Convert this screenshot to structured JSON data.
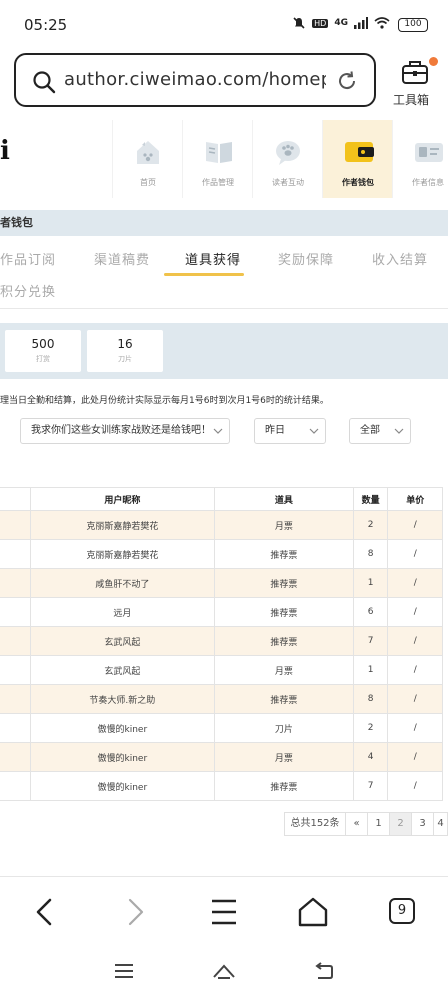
{
  "status_bar": {
    "time": "05:25",
    "network": "4G",
    "hd": "HD",
    "battery": "100"
  },
  "url_bar": {
    "url": "author.ciweimao.com/homepa⋯"
  },
  "toolbox": {
    "label": "工具箱"
  },
  "logo_fragment": "i",
  "nav": [
    {
      "label": "首页",
      "icon": "home-icon"
    },
    {
      "label": "作品管理",
      "icon": "book-icon"
    },
    {
      "label": "读者互动",
      "icon": "paw-chat-icon"
    },
    {
      "label": "作者钱包",
      "icon": "wallet-icon",
      "active": true
    },
    {
      "label": "作者信息",
      "icon": "id-card-icon"
    }
  ],
  "section_title": "者钱包",
  "tabs": [
    {
      "label": "作品订阅"
    },
    {
      "label": "渠道稿费"
    },
    {
      "label": "道具获得",
      "active": true
    },
    {
      "label": "奖励保障"
    },
    {
      "label": "收入结算"
    },
    {
      "label": "积分兑换"
    }
  ],
  "stats": [
    {
      "value": "500",
      "caption": "打赏"
    },
    {
      "value": "16",
      "caption": "刀片"
    }
  ],
  "notice": "理当日全勤和结算，此处月份统计实际显示每月1号6时到次月1号6时的统计结果。",
  "filters": {
    "book": "我求你们这些女训练家战败还是给钱吧！",
    "period": "昨日",
    "type": "全部"
  },
  "table": {
    "headers": [
      "用户昵称",
      "道具",
      "数量",
      "单价"
    ],
    "rows": [
      [
        "克丽斯嘉静若樊花",
        "月票",
        "2",
        "/"
      ],
      [
        "克丽斯嘉静若樊花",
        "推荐票",
        "8",
        "/"
      ],
      [
        "咸鱼肝不动了",
        "推荐票",
        "1",
        "/"
      ],
      [
        "远月",
        "推荐票",
        "6",
        "/"
      ],
      [
        "玄武风起",
        "推荐票",
        "7",
        "/"
      ],
      [
        "玄武风起",
        "月票",
        "1",
        "/"
      ],
      [
        "节奏大师.新之助",
        "推荐票",
        "8",
        "/"
      ],
      [
        "傲慢的kiner",
        "刀片",
        "2",
        "/"
      ],
      [
        "傲慢的kiner",
        "月票",
        "4",
        "/"
      ],
      [
        "傲慢的kiner",
        "推荐票",
        "7",
        "/"
      ]
    ]
  },
  "pagination": {
    "total": "总共152条",
    "prev": "«",
    "pages": [
      "1",
      "2",
      "3",
      "4"
    ],
    "current": "2"
  },
  "browser_bar": {
    "tab_count": "9"
  }
}
